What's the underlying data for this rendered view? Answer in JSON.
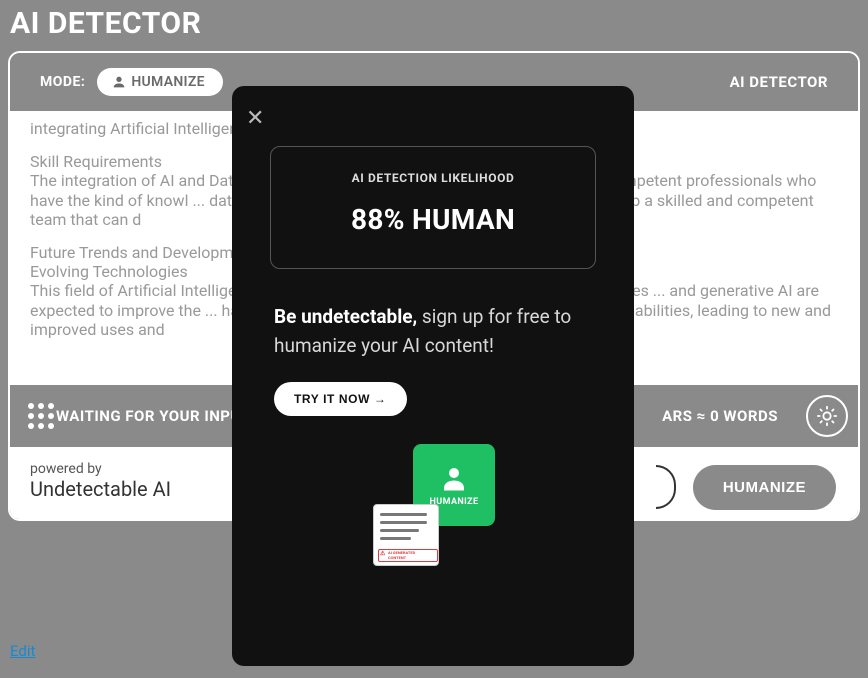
{
  "header": {
    "page_title": "AI DETECTOR",
    "mode_label": "MODE:",
    "humanize_pill": "HUMANIZE",
    "ai_detector_label": "AI DETECTOR"
  },
  "body_text": {
    "p1": "integrating Artificial Intelligence ... the challenges that organizations need to deal w",
    "p2_title": "Skill Requirements",
    "p2": "The integration of AI and Data ... comprehensively understands the two. It may ... competent professionals who have the kind of knowl ... data engineering. To promote AI and Data Science ... develop a skilled and competent team that can d",
    "p3_title": "Future Trends and Developments",
    "p3_sub": "Evolving Technologies",
    "p3": "This field of Artificial Intelligence ... that is going to be made is huge. Such technologies ... and generative AI are expected to improve the ... have the potential to increase data processing rates ... capabilities, leading to new and improved uses and"
  },
  "status": {
    "waiting": "WAITING FOR YOUR INPUT",
    "counts": "ARS ≈ 0 WORDS"
  },
  "footer": {
    "powered_by": "powered by",
    "brand": "Undetectable AI",
    "humanize_button": "HUMANIZE"
  },
  "edit_link": "Edit",
  "modal": {
    "result_label": "AI DETECTION LIKELIHOOD",
    "result_value": "88% HUMAN",
    "cta_bold": "Be undetectable,",
    "cta_rest": " sign up for free to humanize your AI content!",
    "try_button": "TRY IT NOW →",
    "ill_green_label": "HUMANIZE",
    "ill_badge": "AI GENERATED CONTENT"
  }
}
